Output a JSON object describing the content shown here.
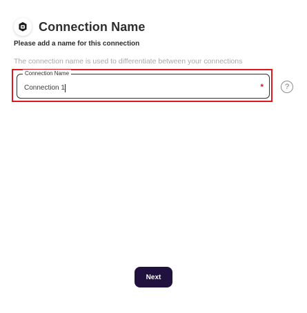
{
  "header": {
    "logo_icon": "connection-logo-icon",
    "title": "Connection Name"
  },
  "subtitle": "Please add a name for this connection",
  "helper_text": "The connection name is used to differentiate between your connections",
  "field": {
    "label": "Connection Name",
    "value": "Connection 1",
    "required_marker": "*",
    "help_icon": "question-mark-icon",
    "help_glyph": "?"
  },
  "actions": {
    "next_label": "Next"
  },
  "colors": {
    "highlight_border": "#e0161c",
    "button_bg": "#20113e",
    "helper_text": "#a9a9a9"
  }
}
